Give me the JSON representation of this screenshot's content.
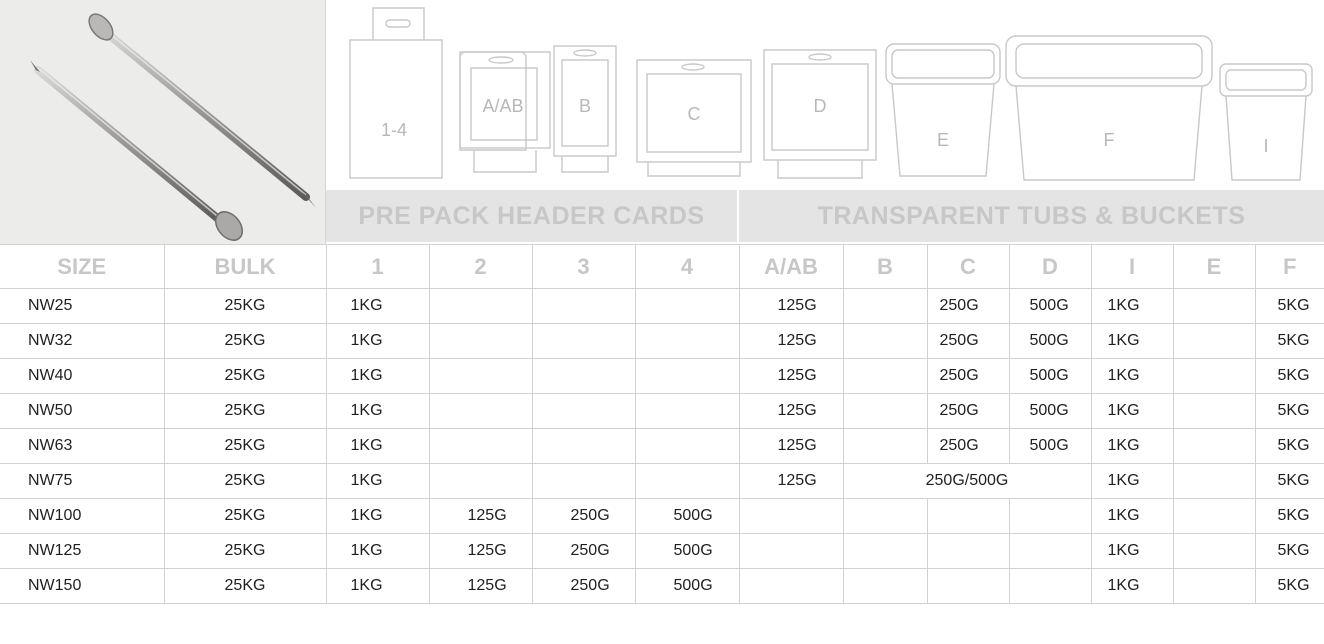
{
  "header": {
    "band_pre": "PRE PACK HEADER CARDS",
    "band_tubs": "TRANSPARENT TUBS & BUCKETS"
  },
  "illustrations": {
    "pack_1_4": "1-4",
    "pack_aab": "A/AB",
    "pack_b": "B",
    "pack_c": "C",
    "pack_d": "D",
    "tub_e": "E",
    "tub_f": "F",
    "tub_i": "I",
    "line_color": "#c8c8c8"
  },
  "photo": {
    "icon": "nails-photo-icon",
    "background": "#ececeb"
  },
  "columns": [
    "SIZE",
    "BULK",
    "1",
    "2",
    "3",
    "4",
    "A/AB",
    "B",
    "C",
    "D",
    "I",
    "E",
    "F"
  ],
  "rows": [
    {
      "size": "NW25",
      "bulk": "25KG",
      "c1": "1KG",
      "c2": "",
      "c3": "",
      "c4": "",
      "aab": "125G",
      "b": "",
      "c": "250G",
      "d": "500G",
      "i": "1KG",
      "e": "",
      "f": "5KG"
    },
    {
      "size": "NW32",
      "bulk": "25KG",
      "c1": "1KG",
      "c2": "",
      "c3": "",
      "c4": "",
      "aab": "125G",
      "b": "",
      "c": "250G",
      "d": "500G",
      "i": "1KG",
      "e": "",
      "f": "5KG"
    },
    {
      "size": "NW40",
      "bulk": "25KG",
      "c1": "1KG",
      "c2": "",
      "c3": "",
      "c4": "",
      "aab": "125G",
      "b": "",
      "c": "250G",
      "d": "500G",
      "i": "1KG",
      "e": "",
      "f": "5KG"
    },
    {
      "size": "NW50",
      "bulk": "25KG",
      "c1": "1KG",
      "c2": "",
      "c3": "",
      "c4": "",
      "aab": "125G",
      "b": "",
      "c": "250G",
      "d": "500G",
      "i": "1KG",
      "e": "",
      "f": "5KG"
    },
    {
      "size": "NW63",
      "bulk": "25KG",
      "c1": "1KG",
      "c2": "",
      "c3": "",
      "c4": "",
      "aab": "125G",
      "b": "",
      "c": "250G",
      "d": "500G",
      "i": "1KG",
      "e": "",
      "f": "5KG"
    },
    {
      "size": "NW75",
      "bulk": "25KG",
      "c1": "1KG",
      "c2": "",
      "c3": "",
      "c4": "",
      "aab": "125G",
      "bc_merged": "250G/500G",
      "i": "1KG",
      "e": "",
      "f": "5KG"
    },
    {
      "size": "NW100",
      "bulk": "25KG",
      "c1": "1KG",
      "c2": "125G",
      "c3": "250G",
      "c4": "500G",
      "aab": "",
      "b": "",
      "c": "",
      "d": "",
      "i": "1KG",
      "e": "",
      "f": "5KG"
    },
    {
      "size": "NW125",
      "bulk": "25KG",
      "c1": "1KG",
      "c2": "125G",
      "c3": "250G",
      "c4": "500G",
      "aab": "",
      "b": "",
      "c": "",
      "d": "",
      "i": "1KG",
      "e": "",
      "f": "5KG"
    },
    {
      "size": "NW150",
      "bulk": "25KG",
      "c1": "1KG",
      "c2": "125G",
      "c3": "250G",
      "c4": "500G",
      "aab": "",
      "b": "",
      "c": "",
      "d": "",
      "i": "1KG",
      "e": "",
      "f": "5KG"
    }
  ]
}
